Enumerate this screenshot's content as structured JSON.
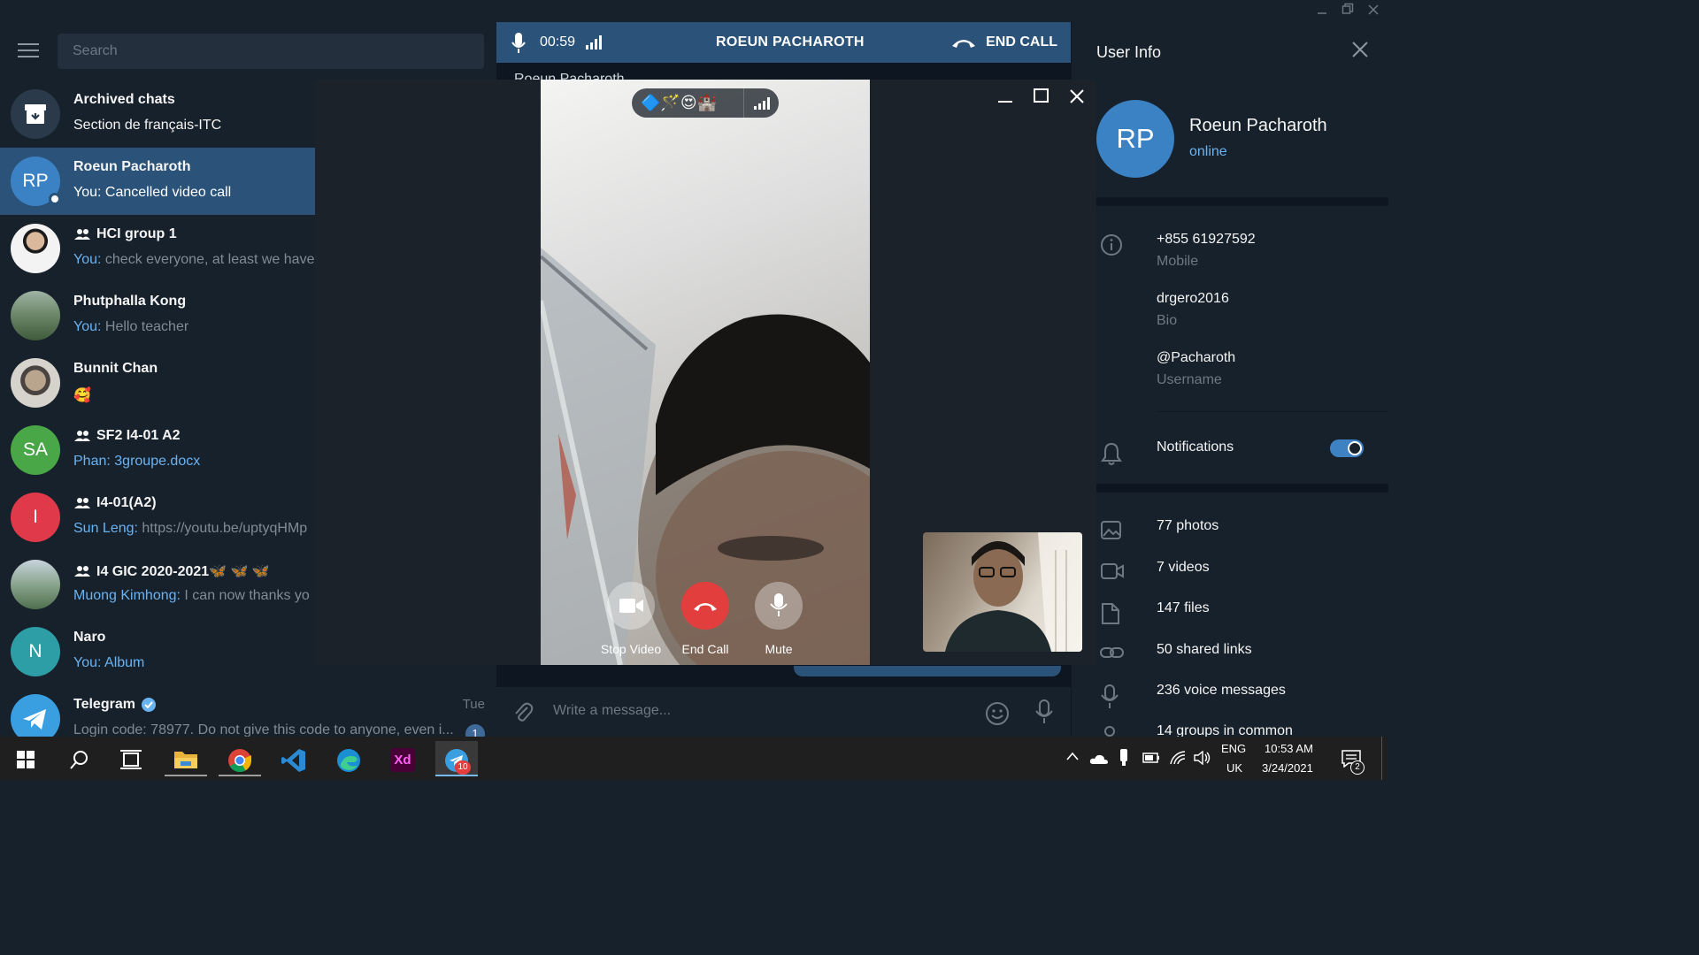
{
  "search": {
    "placeholder": "Search"
  },
  "chats": [
    {
      "name": "Archived chats",
      "preview": "Section de français-ITC",
      "avatar": "archive-icon",
      "group": false
    },
    {
      "name": "Roeun Pacharoth",
      "prefix": "You: ",
      "preview": "Cancelled video call",
      "initials": "RP",
      "color": "#3b82c4",
      "active": true,
      "online": true
    },
    {
      "name": "HCI group 1",
      "prefix": "You: ",
      "preview": "check everyone, at least we have",
      "group": true
    },
    {
      "name": "Phutphalla Kong",
      "prefix": "You: ",
      "preview": "Hello teacher"
    },
    {
      "name": "Bunnit Chan",
      "preview": "🥰"
    },
    {
      "name": "SF2 I4-01 A2",
      "prefix": "Phan: ",
      "preview": "3groupe.docx",
      "initials": "SA",
      "color": "#4aa747",
      "group": true
    },
    {
      "name": "I4-01(A2)",
      "prefix": "Sun Leng: ",
      "preview": "https://youtu.be/uptyqHMp",
      "initials": "I",
      "color": "#e0394a",
      "group": true
    },
    {
      "name": "I4 GIC 2020-2021🦋 🦋 🦋",
      "prefix": "Muong Kimhong: ",
      "preview": "I can now thanks yo",
      "group": true
    },
    {
      "name": "Naro",
      "prefix": "You: ",
      "preview": "Album",
      "initials": "N",
      "color": "#2d9ea6"
    },
    {
      "name": "Telegram",
      "preview": "Login code: 78977. Do not give this code to anyone, even i...",
      "time": "Tue",
      "badge": "1",
      "verified": true
    }
  ],
  "call": {
    "timer": "00:59",
    "peer_name": "ROEUN PACHAROTH",
    "end_label": "END CALL",
    "peek_name": "Roeun Pacharoth",
    "emojis": "🔷🪄😍🏰",
    "controls": {
      "stop_video": "Stop Video",
      "end_call": "End Call",
      "mute": "Mute"
    }
  },
  "composer": {
    "placeholder": "Write a message..."
  },
  "user_info": {
    "title": "User Info",
    "initials": "RP",
    "name": "Roeun Pacharoth",
    "status": "online",
    "phone": "+855 61927592",
    "phone_label": "Mobile",
    "bio": "drgero2016",
    "bio_label": "Bio",
    "username": "@Pacharoth",
    "username_label": "Username",
    "notifications": "Notifications",
    "notifications_on": true,
    "media": [
      {
        "icon": "photo-icon",
        "label": "77 photos"
      },
      {
        "icon": "video-icon",
        "label": "7 videos"
      },
      {
        "icon": "file-icon",
        "label": "147 files"
      },
      {
        "icon": "link-icon",
        "label": "50 shared links"
      },
      {
        "icon": "mic-icon",
        "label": "236 voice messages"
      },
      {
        "icon": "user-icon",
        "label": "14 groups in common"
      }
    ]
  },
  "taskbar": {
    "telegram_badge": "10",
    "lang_top": "ENG",
    "lang_bottom": "UK",
    "time": "10:53 AM",
    "date": "3/24/2021",
    "notif_count": "2"
  }
}
